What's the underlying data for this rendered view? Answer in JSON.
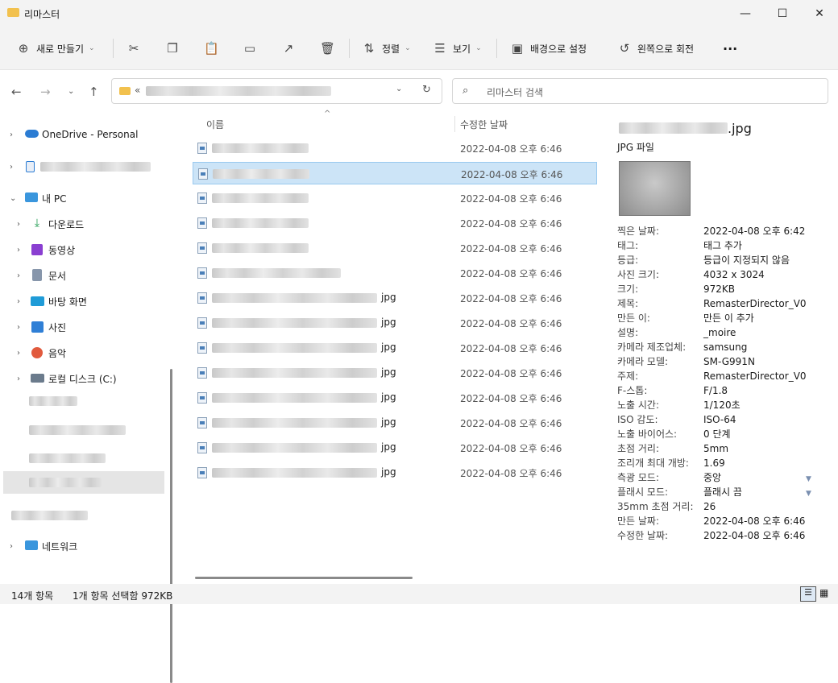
{
  "window": {
    "title": "리마스터",
    "minimize": "—",
    "maximize": "☐",
    "close": "✕"
  },
  "toolbar": {
    "new_label": "새로 만들기",
    "sort_label": "정렬",
    "view_label": "보기",
    "wallpaper_label": "배경으로 설정",
    "rotate_label": "왼쪽으로 회전",
    "more_label": "···"
  },
  "address": {
    "prefix": "«"
  },
  "search": {
    "placeholder": "리마스터 검색"
  },
  "sidebar": {
    "items": [
      {
        "label": "OneDrive - Personal"
      },
      {
        "label": "내 PC"
      },
      {
        "label": "다운로드"
      },
      {
        "label": "동영상"
      },
      {
        "label": "문서"
      },
      {
        "label": "바탕 화면"
      },
      {
        "label": "사진"
      },
      {
        "label": "음악"
      },
      {
        "label": "로컬 디스크 (C:)"
      },
      {
        "label": "네트워크"
      }
    ]
  },
  "list": {
    "col_name": "이름",
    "col_date": "수정한 날짜",
    "rows": [
      {
        "ext": "",
        "date": "2022-04-08 오후 6:46"
      },
      {
        "ext": "",
        "date": "2022-04-08 오후 6:46"
      },
      {
        "ext": "",
        "date": "2022-04-08 오후 6:46"
      },
      {
        "ext": "",
        "date": "2022-04-08 오후 6:46"
      },
      {
        "ext": "",
        "date": "2022-04-08 오후 6:46"
      },
      {
        "ext": "",
        "date": "2022-04-08 오후 6:46"
      },
      {
        "ext": "jpg",
        "date": "2022-04-08 오후 6:46"
      },
      {
        "ext": "jpg",
        "date": "2022-04-08 오후 6:46"
      },
      {
        "ext": "jpg",
        "date": "2022-04-08 오후 6:46"
      },
      {
        "ext": "jpg",
        "date": "2022-04-08 오후 6:46"
      },
      {
        "ext": "jpg",
        "date": "2022-04-08 오후 6:46"
      },
      {
        "ext": "jpg",
        "date": "2022-04-08 오후 6:46"
      },
      {
        "ext": "jpg",
        "date": "2022-04-08 오후 6:46"
      },
      {
        "ext": "jpg",
        "date": "2022-04-08 오후 6:46"
      }
    ]
  },
  "preview": {
    "filename_ext": ".jpg",
    "filetype": "JPG 파일",
    "props": [
      {
        "k": "찍은 날짜:",
        "v": "2022-04-08 오후 6:42"
      },
      {
        "k": "태그:",
        "v": "태그 추가"
      },
      {
        "k": "등급:",
        "v": "등급이 지정되지 않음"
      },
      {
        "k": "사진 크기:",
        "v": "4032 x 3024"
      },
      {
        "k": "크기:",
        "v": "972KB"
      },
      {
        "k": "제목:",
        "v": "RemasterDirector_V0"
      },
      {
        "k": "만든 이:",
        "v": "만든 이 추가"
      },
      {
        "k": "설명:",
        "v": "_moire"
      },
      {
        "k": "카메라 제조업체:",
        "v": "samsung"
      },
      {
        "k": "카메라 모델:",
        "v": "SM-G991N"
      },
      {
        "k": "주제:",
        "v": "RemasterDirector_V0"
      },
      {
        "k": "F-스톱:",
        "v": "F/1.8"
      },
      {
        "k": "노출 시간:",
        "v": "1/120초"
      },
      {
        "k": "ISO 감도:",
        "v": "ISO-64"
      },
      {
        "k": "노출 바이어스:",
        "v": "0 단계"
      },
      {
        "k": "초점 거리:",
        "v": "5mm"
      },
      {
        "k": "조리개 최대 개방:",
        "v": "1.69"
      },
      {
        "k": "측광 모드:",
        "v": "중앙"
      },
      {
        "k": "플래시 모드:",
        "v": "플래시 끔"
      },
      {
        "k": "35mm 초점 거리:",
        "v": "26"
      },
      {
        "k": "만든 날짜:",
        "v": "2022-04-08 오후 6:46"
      },
      {
        "k": "수정한 날짜:",
        "v": "2022-04-08 오후 6:46"
      }
    ]
  },
  "status": {
    "count": "14개 항목",
    "selected": "1개 항목 선택함 972KB"
  }
}
